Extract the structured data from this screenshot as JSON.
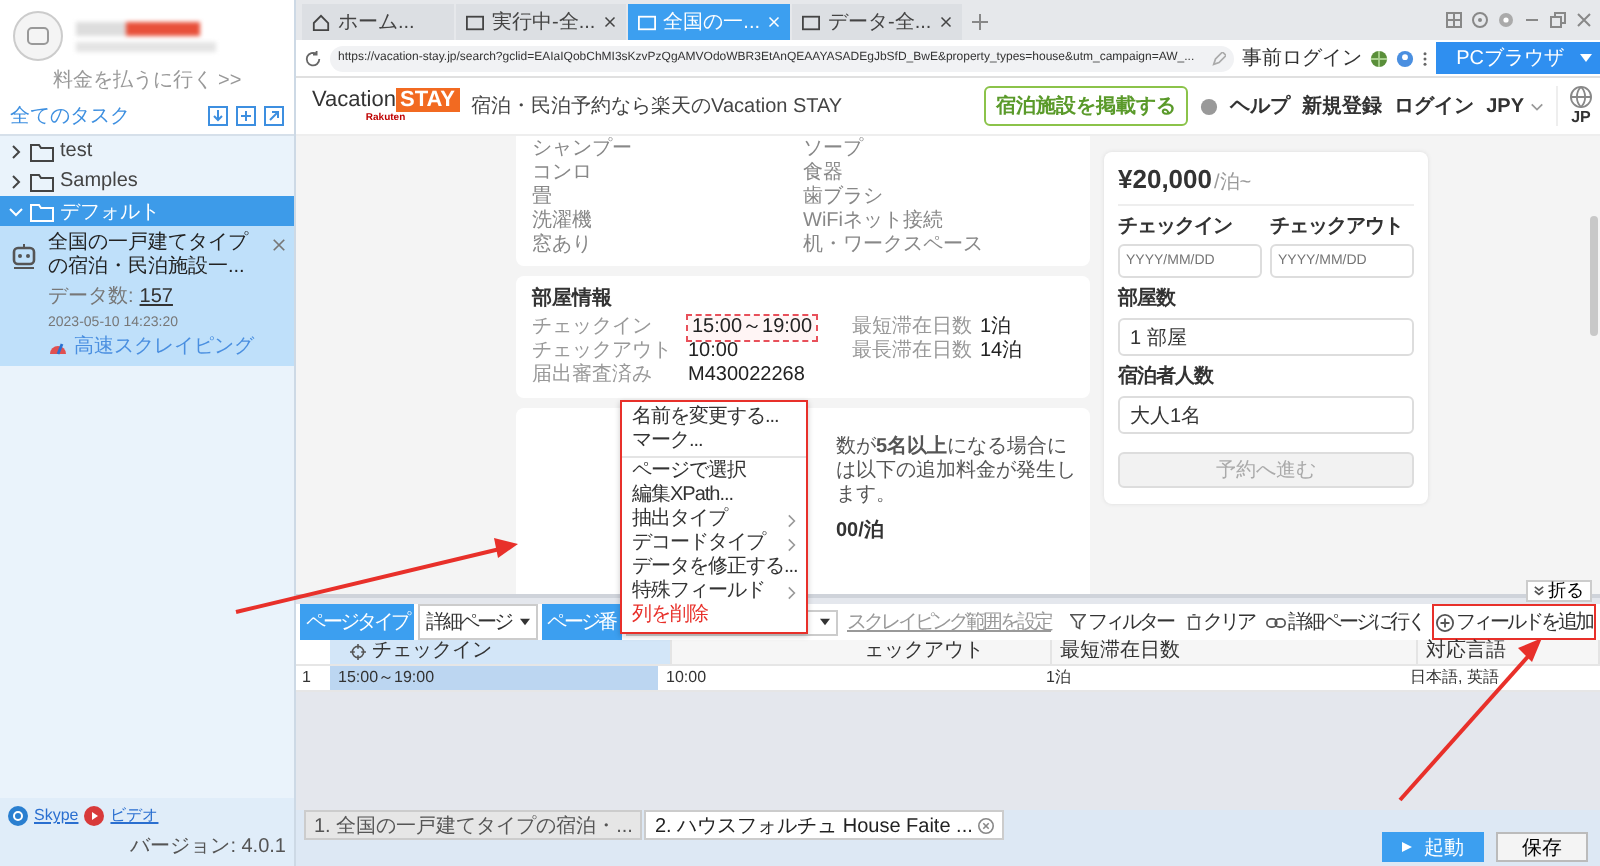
{
  "sidebar": {
    "pay_link": "料金を払うに行く >>",
    "section_title": "全てのタスク",
    "tree": [
      {
        "label": "test",
        "expanded": false,
        "selected": false
      },
      {
        "label": "Samples",
        "expanded": false,
        "selected": false
      },
      {
        "label": "デフォルト",
        "expanded": true,
        "selected": true,
        "children": [
          {
            "title": "全国の一戸建てタイプの宿泊・民泊施設一...",
            "count_label": "データ数:",
            "count": "157",
            "time": "2023-05-10 14:23:20",
            "mode": "高速スクレイピング"
          }
        ]
      }
    ],
    "footer": {
      "links": [
        "Skype",
        "ビデオ"
      ],
      "version": "バージョン: 4.0.1"
    }
  },
  "browser": {
    "tabs": [
      {
        "kind": "home",
        "label": "ホーム...",
        "closable": false,
        "selected": false
      },
      {
        "kind": "page",
        "label": "実行中-全...",
        "closable": true,
        "selected": false
      },
      {
        "kind": "page",
        "label": "全国の一...",
        "closable": true,
        "selected": true
      },
      {
        "kind": "page",
        "label": "データ-全...",
        "closable": true,
        "selected": false
      }
    ],
    "url": "https://vacation-stay.jp/search?gclid=EAIaIQobChMI3sKzvPzQgAMVOdoWBR3EtAnQEAAYASADEgJbSfD_BwE&property_types=house&utm_campaign=AW_...",
    "pre_login": "事前ログイン",
    "mode_button": "PCブラウザ"
  },
  "page": {
    "header": {
      "logo": {
        "word": "Vacation",
        "badge": "STAY",
        "sub": "Rakuten"
      },
      "tagline": "宿泊・民泊予約なら楽天のVacation STAY",
      "list_button": "宿泊施設を掲載する",
      "nav": [
        "ヘルプ",
        "新規登録",
        "ログイン"
      ],
      "currency": "JPY",
      "region": "JP"
    },
    "amenities": [
      "シャンプー",
      "ソープ",
      "コンロ",
      "食器",
      "畳",
      "歯ブラシ",
      "洗濯機",
      "WiFiネット接続",
      "窓あり",
      "机・ワークスペース"
    ],
    "room_info": {
      "title": "部屋情報",
      "fields": [
        {
          "label": "チェックイン",
          "value": "15:00～19:00",
          "highlighted": true
        },
        {
          "label": "最短滞在日数",
          "value": "1泊",
          "highlighted": false
        },
        {
          "label": "チェックアウト",
          "value": "10:00",
          "highlighted": false
        },
        {
          "label": "最長滞在日数",
          "value": "14泊",
          "highlighted": false
        },
        {
          "label": "届出審査済み",
          "value": "M430022268",
          "highlighted": false
        }
      ]
    },
    "notice": {
      "text": "数が**5名以上**になる場合には以下の追加料金が発生します。",
      "price": "00/泊"
    },
    "booking": {
      "price": "¥20,000",
      "per": "/泊~",
      "checkin_label": "チェックイン",
      "checkout_label": "チェックアウト",
      "checkin_placeholder": "YYYY/MM/DD",
      "checkout_placeholder": "YYYY/MM/DD",
      "rooms_label": "部屋数",
      "rooms": "1 部屋",
      "guests_label": "宿泊者人数",
      "guests": "大人1名",
      "submit": "予約へ進む",
      "submit_disabled": true
    }
  },
  "context_menu": {
    "groups": [
      [
        {
          "label": "名前を変更する...",
          "submenu": false,
          "danger": false
        },
        {
          "label": "マーク...",
          "submenu": false,
          "danger": false
        }
      ],
      [
        {
          "label": "ページで選択",
          "submenu": false,
          "danger": false
        },
        {
          "label": "編集XPath...",
          "submenu": false,
          "danger": false
        },
        {
          "label": "抽出タイプ",
          "submenu": true,
          "danger": false
        },
        {
          "label": "デコードタイプ",
          "submenu": true,
          "danger": false
        },
        {
          "label": "データを修正する...",
          "submenu": false,
          "danger": false
        },
        {
          "label": "特殊フィールド",
          "submenu": true,
          "danger": false
        },
        {
          "label": "列を削除",
          "submenu": false,
          "danger": true
        }
      ]
    ]
  },
  "panel": {
    "fold": "折る",
    "page_type_label": "ページタイプ",
    "page_type": "詳細ページ",
    "page_number_label": "ページ番",
    "range_link": "スクレイピング範囲を設定",
    "actions": [
      {
        "kind": "filter",
        "label": "フィルター",
        "highlighted": false
      },
      {
        "kind": "clear",
        "label": "クリア",
        "highlighted": false
      },
      {
        "kind": "link",
        "label": "詳細ページに行く",
        "highlighted": false
      },
      {
        "kind": "add",
        "label": "フィールドを追加",
        "highlighted": true
      }
    ],
    "table": {
      "columns": [
        {
          "label": "チェックイン",
          "selected": true
        },
        {
          "label": "ェックアウト",
          "selected": false
        },
        {
          "label": "最短滞在日数",
          "selected": false
        },
        {
          "label": "対応言語",
          "selected": false
        }
      ],
      "rows": [
        {
          "index": "1",
          "cells": [
            "15:00～19:00",
            "10:00",
            "1泊",
            "日本語, 英語"
          ]
        }
      ]
    },
    "run_tabs": [
      {
        "label": "1. 全国の一戸建てタイプの宿泊・...",
        "selected": false
      },
      {
        "label": "2. ハウスフォルチュ House Faite ...",
        "selected": true
      }
    ],
    "run_button": "起動",
    "save_button": "保存"
  }
}
